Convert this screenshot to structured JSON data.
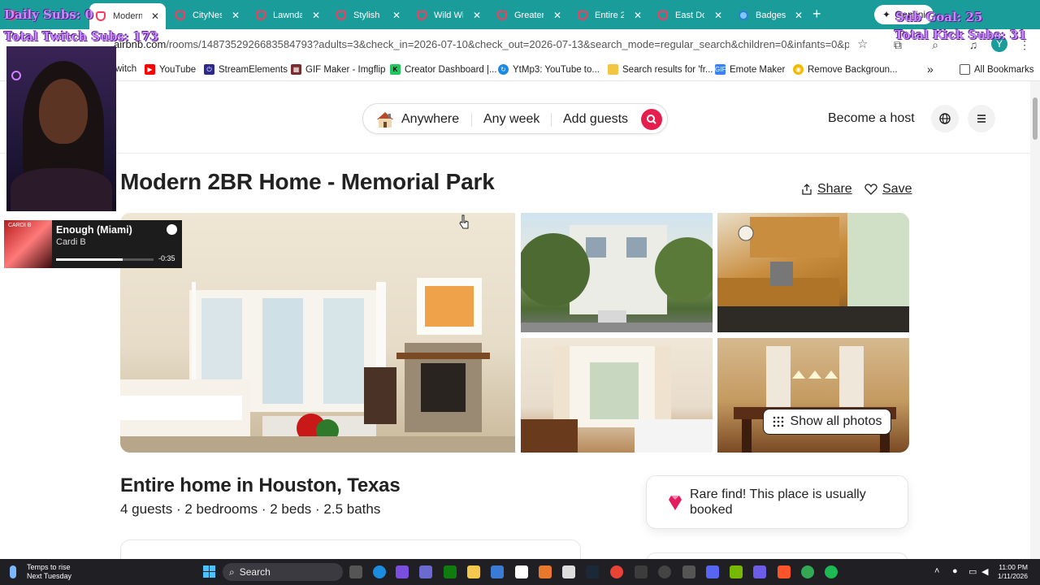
{
  "tabs": [
    {
      "label": "Modern",
      "active": true
    },
    {
      "label": "CityNes",
      "active": false
    },
    {
      "label": "Lawnda",
      "active": false
    },
    {
      "label": "Stylish L",
      "active": false
    },
    {
      "label": "Wild Wi",
      "active": false
    },
    {
      "label": "Greater",
      "active": false
    },
    {
      "label": "Entire 2",
      "active": false
    },
    {
      "label": "East Do",
      "active": false
    },
    {
      "label": "Badges",
      "active": false
    }
  ],
  "new_tab_label": "+",
  "gemini_label": "Gemini",
  "address": {
    "url_host": "airbnb.com",
    "url_path": "/rooms/1487352926683584793?adults=3&check_in=2026-07-10&check_out=2026-07-13&search_mode=regular_search&children=0&infants=0&pets=0&ss..."
  },
  "profile_initial": "Y",
  "bookmarks": [
    {
      "label": "witch",
      "icon": "twitch-icon",
      "color": "#9146ff"
    },
    {
      "label": "YouTube",
      "icon": "youtube-icon",
      "color": "#ff0000"
    },
    {
      "label": "StreamElements",
      "icon": "streamelements-icon",
      "color": "#2e2a8c"
    },
    {
      "label": "GIF Maker - Imgflip",
      "icon": "imgflip-icon",
      "color": "#7a2d2d"
    },
    {
      "label": "Creator Dashboard |...",
      "icon": "kick-icon",
      "color": "#22c55e"
    },
    {
      "label": "YtMp3: YouTube to...",
      "icon": "ytmp3-icon",
      "color": "#1e88e5"
    },
    {
      "label": "Search results for 'fr...",
      "icon": "folder-icon",
      "color": "#f4c542"
    },
    {
      "label": "Emote Maker",
      "icon": "gif-icon",
      "color": "#3b82f6"
    },
    {
      "label": "Remove Backgroun...",
      "icon": "removebg-icon",
      "color": "#f5b800"
    }
  ],
  "bookmarks_overflow": "»",
  "all_bookmarks_label": "All Bookmarks",
  "overlay": {
    "daily_subs": "Daily Subs: 0",
    "sub_goal": "Sub Goal: 25",
    "twitch_subs": "Total Twitch Subs: 173",
    "kick_subs": "Total Kick Subs: 31",
    "color": "#c78bff"
  },
  "spotify": {
    "song": "Enough (Miami)",
    "artist": "Cardi B",
    "time_remaining": "-0:35",
    "progress": 0.68,
    "album_text": "CARDI B"
  },
  "airbnb": {
    "brand_color": "#ff385c",
    "search": {
      "where": "Anywhere",
      "when": "Any week",
      "who": "Add guests"
    },
    "become_host": "Become a host",
    "listing_title": "Modern 2BR Home - Memorial Park",
    "share_label": "Share",
    "save_label": "Save",
    "show_all_photos": "Show all photos",
    "home_type": "Entire home in Houston, Texas",
    "details": "4 guests · 2 bedrooms · 2 beds · 2.5 baths",
    "rare_find": "Rare find! This place is usually booked"
  },
  "taskbar": {
    "weather_line1": "Temps to rise",
    "weather_line2": "Next Tuesday",
    "search_label": "Search",
    "time": "11:00 PM",
    "date": "1/11/2026"
  }
}
